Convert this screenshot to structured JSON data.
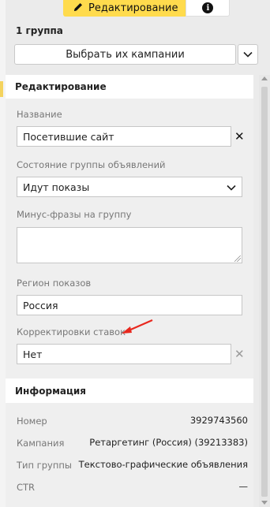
{
  "tabs": {
    "edit_label": "Редактирование",
    "info_glyph": "i"
  },
  "group_title": "1 группа",
  "select_campaigns_label": "Выбрать их кампании",
  "edit_section": {
    "title": "Редактирование",
    "name_label": "Название",
    "name_value": "Посетившие сайт",
    "status_label": "Состояние группы объявлений",
    "status_value": "Идут показы",
    "minus_label": "Минус-фразы на группу",
    "minus_value": "",
    "region_label": "Регион показов",
    "region_value": "Россия",
    "bid_label": "Корректировки ставок",
    "bid_value": "Нет"
  },
  "info_section": {
    "title": "Информация",
    "rows": [
      {
        "key": "Номер",
        "value": "3929743560"
      },
      {
        "key": "Кампания",
        "value": "Ретаргетинг (Россия) (39213383)"
      },
      {
        "key": "Тип группы",
        "value": "Текстово-графические объявления"
      },
      {
        "key": "CTR",
        "value": "—"
      }
    ]
  },
  "colors": {
    "accent": "#ffdb4d",
    "arrow": "#e8281e"
  }
}
